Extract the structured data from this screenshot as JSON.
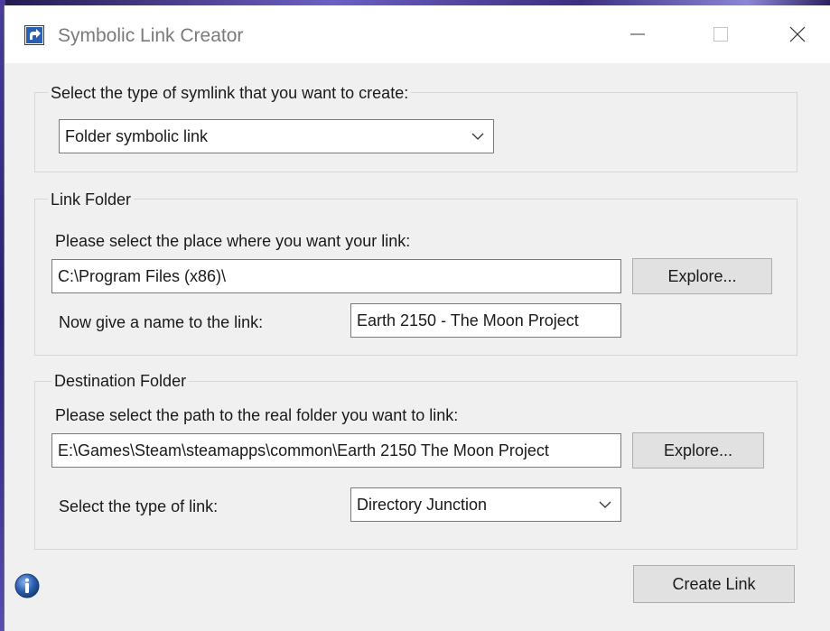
{
  "window": {
    "title": "Symbolic Link Creator"
  },
  "symlink_type_group": {
    "legend": "Select the type of symlink that you want to create:",
    "selected": "Folder symbolic link"
  },
  "link_folder_group": {
    "legend": "Link Folder",
    "prompt": "Please select the place where you want your link:",
    "path_value": "C:\\Program Files (x86)\\",
    "explore_label": "Explore...",
    "name_prompt": "Now give a name to the link:",
    "name_value": "Earth 2150 - The Moon Project"
  },
  "destination_group": {
    "legend": "Destination Folder",
    "prompt": "Please select the path to the real folder you want to link:",
    "path_value": "E:\\Games\\Steam\\steamapps\\common\\Earth 2150 The Moon Project",
    "explore_label": "Explore...",
    "link_type_prompt": "Select the type of link:",
    "link_type_selected": "Directory Junction"
  },
  "footer": {
    "create_label": "Create Link"
  },
  "icons": {
    "app": "shortcut-arrow-icon",
    "info": "info-icon",
    "minimize": "minimize-icon",
    "maximize": "maximize-icon",
    "close": "close-icon",
    "dropdown": "chevron-down-icon"
  },
  "colors": {
    "window_bg": "#f0f0f0",
    "titlebar_bg": "#ffffff",
    "button_bg": "#e1e1e1",
    "accent_blue": "#2d5fb0"
  }
}
